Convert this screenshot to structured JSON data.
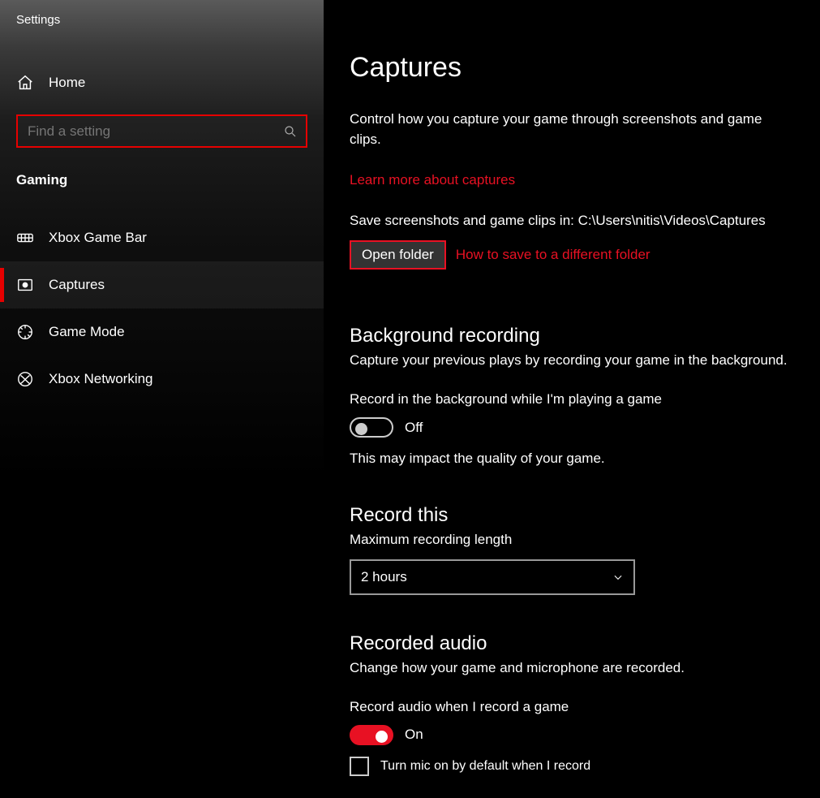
{
  "app_title": "Settings",
  "home_label": "Home",
  "search_placeholder": "Find a setting",
  "category_label": "Gaming",
  "accent_color": "#e81123",
  "nav": [
    {
      "id": "gamebar",
      "label": "Xbox Game Bar",
      "active": false
    },
    {
      "id": "captures",
      "label": "Captures",
      "active": true
    },
    {
      "id": "gamemode",
      "label": "Game Mode",
      "active": false
    },
    {
      "id": "xboxnet",
      "label": "Xbox Networking",
      "active": false
    }
  ],
  "page": {
    "title": "Captures",
    "intro": "Control how you capture your game through screenshots and game clips.",
    "learn_more": "Learn more about captures",
    "save_path_label": "Save screenshots and game clips in: C:\\Users\\nitis\\Videos\\Captures",
    "open_folder_button": "Open folder",
    "how_to_save_link": "How to save to a different folder"
  },
  "background_recording": {
    "heading": "Background recording",
    "subtext": "Capture your previous plays by recording your game in the background.",
    "toggle_label": "Record in the background while I'm playing a game",
    "toggle_state": "Off",
    "note": "This may impact the quality of your game."
  },
  "record_this": {
    "heading": "Record this",
    "max_label": "Maximum recording length",
    "selected": "2 hours"
  },
  "recorded_audio": {
    "heading": "Recorded audio",
    "subtext": "Change how your game and microphone are recorded.",
    "toggle_label": "Record audio when I record a game",
    "toggle_state": "On",
    "checkbox_label": "Turn mic on by default when I record",
    "checkbox_checked": false
  }
}
